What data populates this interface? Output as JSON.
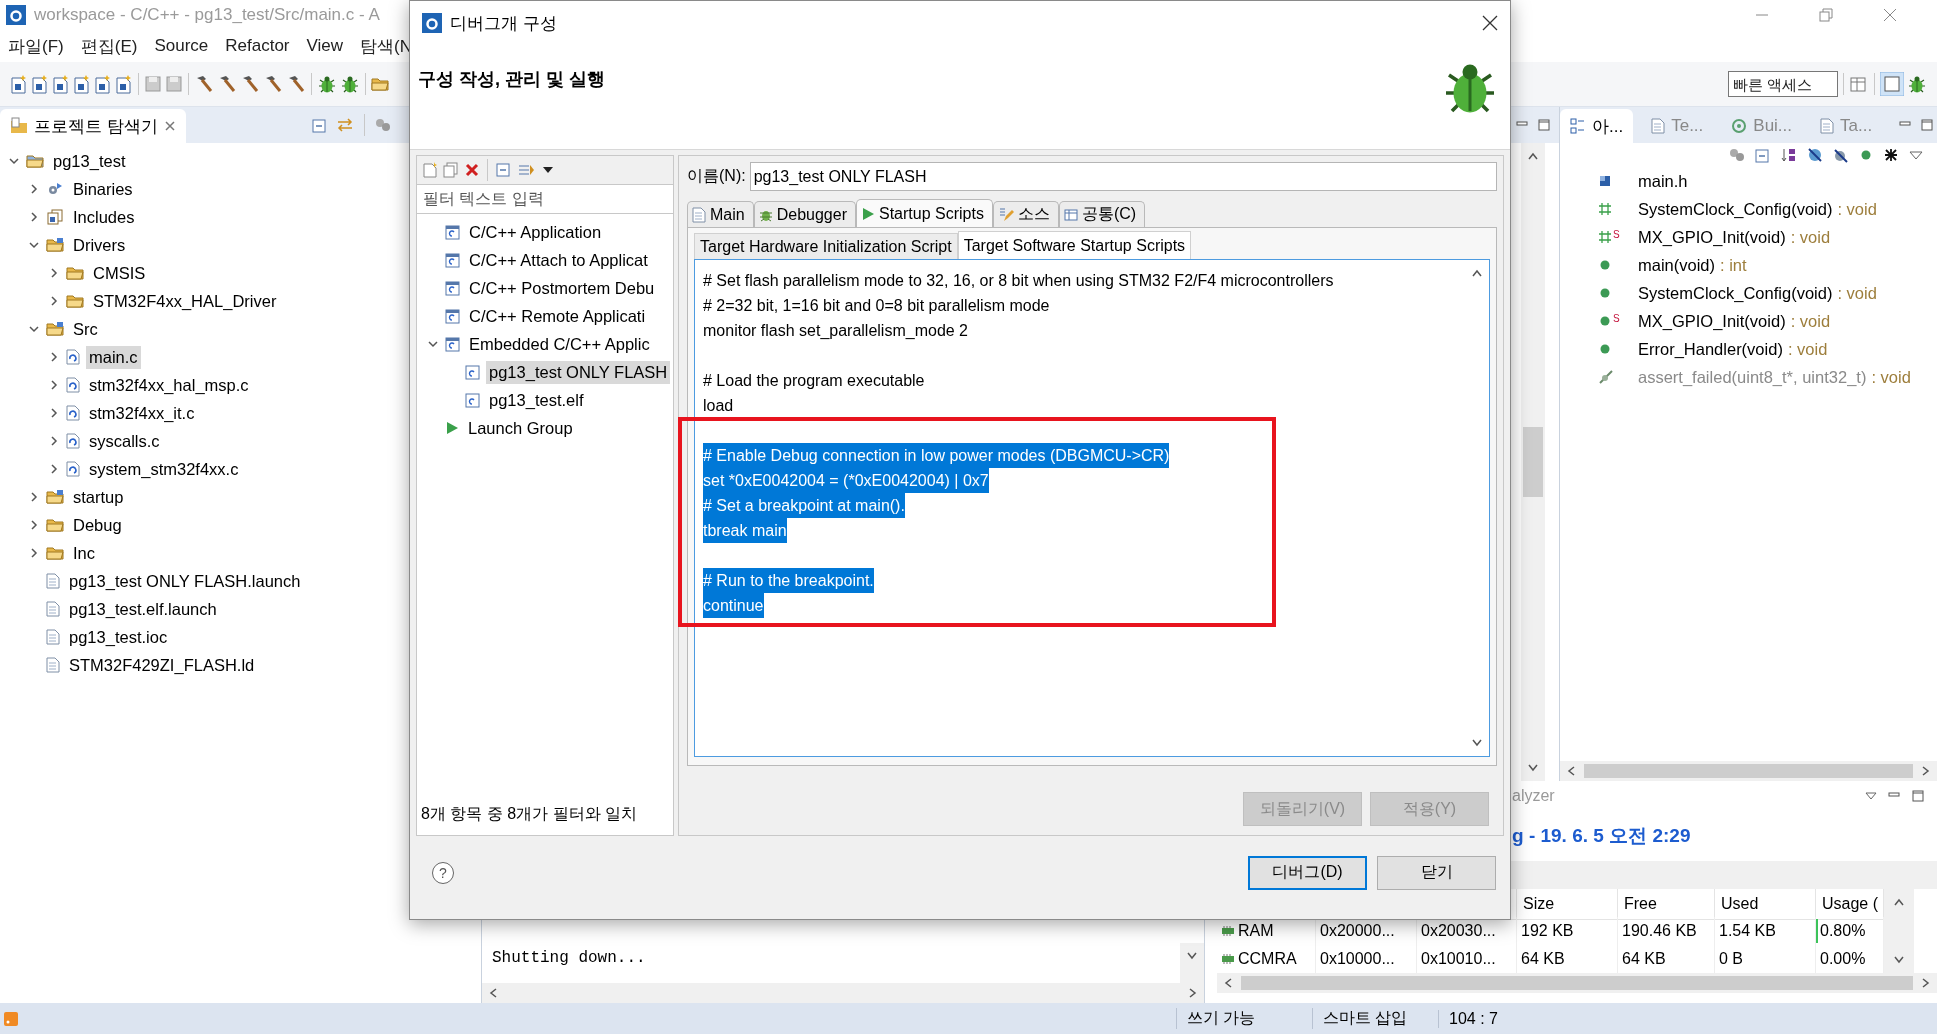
{
  "window": {
    "title": "workspace - C/C++ - pg13_test/Src/main.c - A"
  },
  "menu": [
    "파일(F)",
    "편집(E)",
    "Source",
    "Refactor",
    "View",
    "탐색(N"
  ],
  "quick_access": {
    "placeholder": "빠른 액세스"
  },
  "explorer": {
    "tab": "프로젝트 탐색기",
    "tree": [
      {
        "label": "pg13_test",
        "kind": "project",
        "expanded": true,
        "selected": false,
        "children": [
          {
            "label": "Binaries",
            "kind": "binaries",
            "expanded": false,
            "selected": false
          },
          {
            "label": "Includes",
            "kind": "includes",
            "expanded": false,
            "selected": false
          },
          {
            "label": "Drivers",
            "kind": "source-folder",
            "expanded": true,
            "selected": false,
            "children": [
              {
                "label": "CMSIS",
                "kind": "folder",
                "expanded": false,
                "selected": false
              },
              {
                "label": "STM32F4xx_HAL_Driver",
                "kind": "folder",
                "expanded": false,
                "selected": false
              }
            ]
          },
          {
            "label": "Src",
            "kind": "source-folder",
            "expanded": true,
            "selected": false,
            "children": [
              {
                "label": "main.c",
                "kind": "c-file",
                "expanded": false,
                "selected": true
              },
              {
                "label": "stm32f4xx_hal_msp.c",
                "kind": "c-file",
                "expanded": false,
                "selected": false
              },
              {
                "label": "stm32f4xx_it.c",
                "kind": "c-file",
                "expanded": false,
                "selected": false
              },
              {
                "label": "syscalls.c",
                "kind": "c-file",
                "expanded": false,
                "selected": false
              },
              {
                "label": "system_stm32f4xx.c",
                "kind": "c-file",
                "expanded": false,
                "selected": false
              }
            ]
          },
          {
            "label": "startup",
            "kind": "source-folder",
            "expanded": false,
            "selected": false
          },
          {
            "label": "Debug",
            "kind": "folder",
            "expanded": false,
            "selected": false
          },
          {
            "label": "Inc",
            "kind": "folder",
            "expanded": false,
            "selected": false
          },
          {
            "label": "pg13_test ONLY FLASH.launch",
            "kind": "file",
            "selected": false
          },
          {
            "label": "pg13_test.elf.launch",
            "kind": "file",
            "selected": false
          },
          {
            "label": "pg13_test.ioc",
            "kind": "file",
            "selected": false
          },
          {
            "label": "STM32F429ZI_FLASH.ld",
            "kind": "file",
            "selected": false
          }
        ]
      }
    ]
  },
  "outline": {
    "tabs": [
      {
        "label": "아...",
        "kind": "outline",
        "selected": true
      },
      {
        "label": "Te...",
        "kind": "template",
        "selected": false
      },
      {
        "label": "Bui...",
        "kind": "target",
        "selected": false
      },
      {
        "label": "Ta...",
        "kind": "task",
        "selected": false
      }
    ],
    "items": [
      {
        "kind": "include",
        "name": "main.h"
      },
      {
        "kind": "declaration",
        "name": "SystemClock_Config(void)",
        "type": ": void"
      },
      {
        "kind": "declaration",
        "name": "MX_GPIO_Init(void)",
        "type": ": void",
        "badge": "S"
      },
      {
        "kind": "function",
        "name": "main(void)",
        "type": ": int"
      },
      {
        "kind": "function",
        "name": "SystemClock_Config(void)",
        "type": ": void"
      },
      {
        "kind": "function",
        "name": "MX_GPIO_Init(void)",
        "type": ": void",
        "badge": "S"
      },
      {
        "kind": "function",
        "name": "Error_Handler(void)",
        "type": ": void"
      },
      {
        "kind": "inactive",
        "name": "assert_failed(uint8_t*, uint32_t)",
        "type": ": void"
      }
    ]
  },
  "console": {
    "text": "Shutting down..."
  },
  "analyzer": {
    "title": "alyzer",
    "heading": "g - 19. 6. 5 오전 2:29",
    "columns": [
      "",
      "",
      "",
      "Size",
      "Free",
      "Used",
      "Usage ("
    ],
    "rows": [
      {
        "cells": [
          "RAM",
          "0x20000...",
          "0x20030...",
          "192 KB",
          "190.46 KB",
          "1.54 KB",
          "0.80%"
        ],
        "level": 0.008
      },
      {
        "cells": [
          "CCMRA",
          "0x10000...",
          "0x10010...",
          "64 KB",
          "64 KB",
          "0 B",
          "0.00%"
        ]
      }
    ]
  },
  "status_bar": [
    "쓰기 가능",
    "스마트 삽입",
    "104 : 7"
  ],
  "dialog": {
    "title": "디버그개 구성",
    "heading": "구성 작성, 관리 및 실행",
    "filter": {
      "placeholder": "필터 텍스트 입력"
    },
    "config_tree": [
      {
        "label": "C/C++ Application",
        "kind": "config-type",
        "selected": false
      },
      {
        "label": "C/C++ Attach to Applicat",
        "kind": "config-type",
        "selected": false
      },
      {
        "label": "C/C++ Postmortem Debu",
        "kind": "config-type",
        "selected": false
      },
      {
        "label": "C/C++ Remote Applicati",
        "kind": "config-type",
        "selected": false
      },
      {
        "label": "Embedded C/C++ Applic",
        "kind": "config-type",
        "expanded": true,
        "selected": false,
        "children": [
          {
            "label": "pg13_test ONLY FLASH",
            "kind": "config",
            "selected": true
          },
          {
            "label": "pg13_test.elf",
            "kind": "config",
            "selected": false
          }
        ]
      },
      {
        "label": "Launch Group",
        "kind": "launch-group",
        "selected": false
      }
    ],
    "filter_status": "8개 항목 중 8개가 필터와 일치",
    "name": {
      "label": "이름(N):",
      "value": "pg13_test ONLY FLASH"
    },
    "tabs": [
      {
        "label": "Main",
        "kind": "main",
        "selected": false
      },
      {
        "label": "Debugger",
        "kind": "debugger",
        "selected": false
      },
      {
        "label": "Startup Scripts",
        "kind": "startup",
        "selected": true
      },
      {
        "label": "소스",
        "kind": "source",
        "selected": false
      },
      {
        "label": "공통(C)",
        "kind": "common",
        "selected": false
      }
    ],
    "subtabs": [
      {
        "label": "Target Hardware Initialization Script",
        "selected": false
      },
      {
        "label": "Target Software Startup Scripts",
        "selected": true
      }
    ],
    "script_lines": [
      {
        "kind": "line",
        "text": "# Set flash parallelism mode to 32, 16, or 8 bit when using STM32 F2/F4 microcontrollers",
        "selected": false
      },
      {
        "kind": "line",
        "text": "# 2=32 bit, 1=16 bit and 0=8 bit parallelism mode",
        "selected": false
      },
      {
        "kind": "line",
        "text": "monitor flash set_parallelism_mode 2",
        "selected": false
      },
      {
        "kind": "blank"
      },
      {
        "kind": "line",
        "text": "# Load the program executable",
        "selected": false
      },
      {
        "kind": "line",
        "text": "load",
        "selected": false
      },
      {
        "kind": "blank"
      },
      {
        "kind": "line",
        "text": "# Enable Debug connection in low power modes (DBGMCU->CR)",
        "selected": true
      },
      {
        "kind": "line",
        "text": "set *0xE0042004 = (*0xE0042004) | 0x7",
        "selected": true
      },
      {
        "kind": "line",
        "text": "# Set a breakpoint at main().",
        "selected": true
      },
      {
        "kind": "line",
        "text": "tbreak main",
        "selected": true
      },
      {
        "kind": "blank"
      },
      {
        "kind": "line",
        "text": "# Run to the breakpoint.",
        "selected": true
      },
      {
        "kind": "line",
        "text": "continue",
        "selected": true
      }
    ],
    "annotation_box": true,
    "panel_buttons": [
      {
        "label": "되돌리기(V)",
        "disabled": true
      },
      {
        "label": "적용(Y)",
        "disabled": true
      }
    ],
    "help_button": "?",
    "buttons": [
      {
        "label": "디버그(D)",
        "default": true
      },
      {
        "label": "닫기",
        "default": false
      }
    ]
  }
}
